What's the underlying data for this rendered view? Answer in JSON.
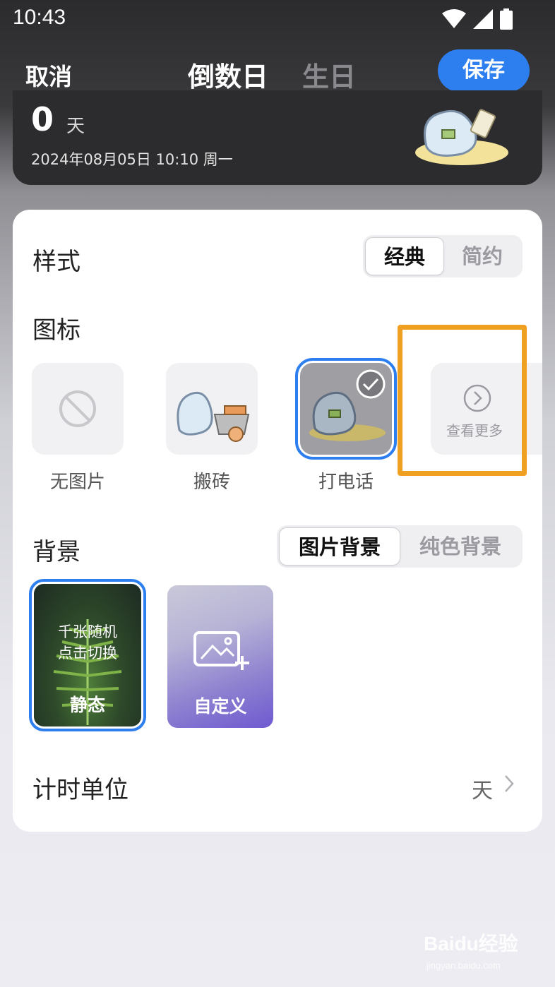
{
  "status_bar": {
    "time": "10:43",
    "icons": [
      "wifi-icon",
      "signal-icon",
      "battery-icon"
    ]
  },
  "header": {
    "cancel": "取消",
    "tabs": [
      {
        "label": "倒数日",
        "active": true
      },
      {
        "label": "生日",
        "active": false
      }
    ],
    "save": "保存"
  },
  "preview": {
    "days": "0",
    "unit": "天",
    "date": "2024年08月05日  10:10  周一"
  },
  "style_section": {
    "label": "样式",
    "options": [
      {
        "label": "经典",
        "active": true
      },
      {
        "label": "简约",
        "active": false
      }
    ]
  },
  "icon_section": {
    "label": "图标",
    "items": [
      {
        "label": "无图片",
        "icon": "no-image-icon",
        "selected": false
      },
      {
        "label": "搬砖",
        "icon": "ghost-cart-icon",
        "selected": false
      },
      {
        "label": "打电话",
        "icon": "ghost-phone-icon",
        "selected": true
      }
    ],
    "more_label": "查看更多"
  },
  "background_section": {
    "label": "背景",
    "options": [
      {
        "label": "图片背景",
        "active": true
      },
      {
        "label": "纯色背景",
        "active": false
      }
    ],
    "tiles": [
      {
        "line1": "千张随机",
        "line2": "点击切换",
        "title": "静态",
        "selected": true
      },
      {
        "title": "自定义",
        "selected": false
      }
    ]
  },
  "timing_unit": {
    "label": "计时单位",
    "value": "天"
  },
  "colors": {
    "accent": "#2d7ff0",
    "highlight": "#f0a020",
    "card_bg": "#ffffff"
  },
  "watermark": {
    "brand": "Baidu经验",
    "url": "jingyan.baidu.com"
  }
}
